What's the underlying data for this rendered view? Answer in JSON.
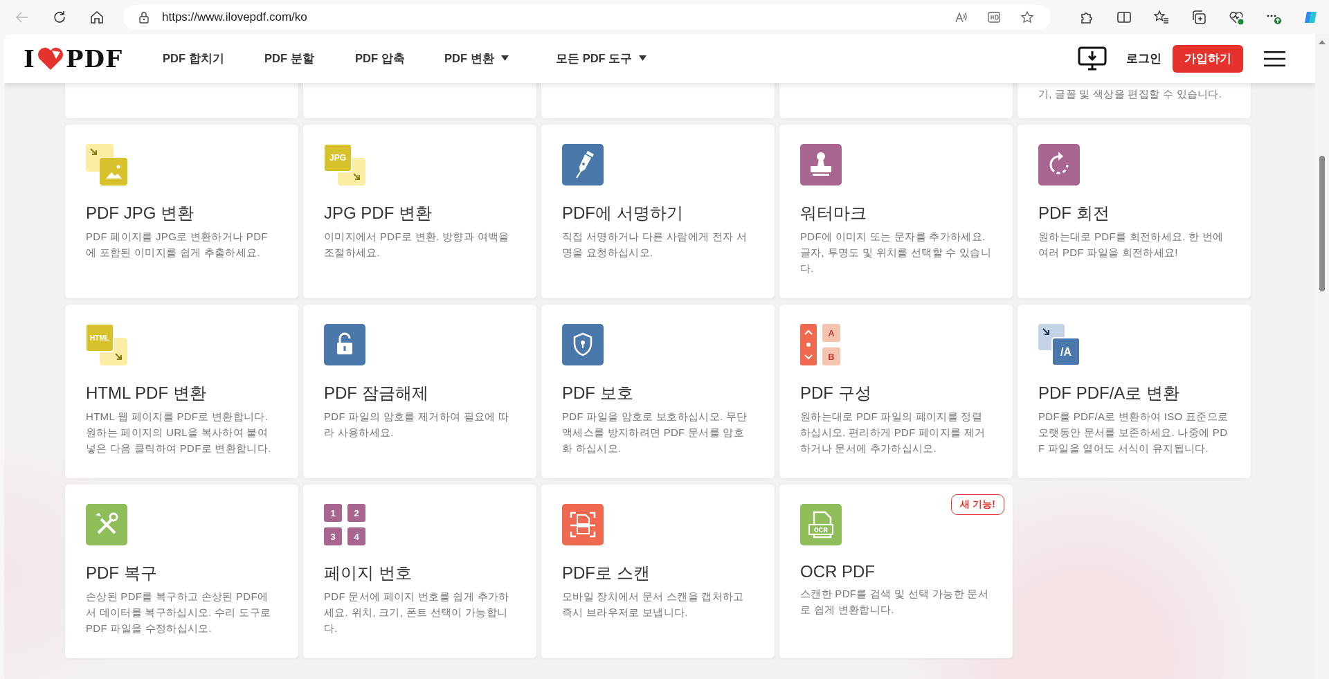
{
  "browser": {
    "url": "https://www.ilovepdf.com/ko"
  },
  "header": {
    "logo": {
      "left": "I",
      "right": "PDF"
    },
    "nav": [
      {
        "label": "PDF 합치기",
        "dropdown": false
      },
      {
        "label": "PDF 분할",
        "dropdown": false
      },
      {
        "label": "PDF 압축",
        "dropdown": false
      },
      {
        "label": "PDF 변환",
        "dropdown": true
      },
      {
        "label": "모든 PDF 도구",
        "dropdown": true
      }
    ],
    "login": "로그인",
    "signup": "가입하기"
  },
  "cut_row": {
    "description": "기, 글꼴 및 색상을 편집할 수 있습니다."
  },
  "tools": [
    {
      "title": "PDF JPG 변환",
      "description": "PDF 페이지를 JPG로 변환하거나 PDF에 포함된 이미지를 쉽게 추출하세요."
    },
    {
      "title": "JPG PDF 변환",
      "description": "이미지에서 PDF로 변환. 방향과 여백을 조절하세요.",
      "icon_text": [
        "JPG"
      ]
    },
    {
      "title": "PDF에 서명하기",
      "description": "직접 서명하거나 다른 사람에게 전자 서명을 요청하십시오."
    },
    {
      "title": "워터마크",
      "description": "PDF에 이미지 또는 문자를 추가하세요. 글자, 투명도 및 위치를 선택할 수 있습니다."
    },
    {
      "title": "PDF 회전",
      "description": "원하는대로 PDF를 회전하세요. 한 번에 여러 PDF 파일을 회전하세요!"
    },
    {
      "title": "HTML PDF 변환",
      "description": "HTML 웹 페이지를 PDF로 변환합니다. 원하는 페이지의 URL을 복사하여 붙여넣은 다음 클릭하여 PDF로 변환합니다.",
      "icon_text": [
        "HTML"
      ]
    },
    {
      "title": "PDF 잠금해제",
      "description": "PDF 파일의 암호를 제거하여 필요에 따라 사용하세요."
    },
    {
      "title": "PDF 보호",
      "description": "PDF 파일을 암호로 보호하십시오. 무단 액세스를 방지하려면 PDF 문서를 암호화 하십시오."
    },
    {
      "title": "PDF 구성",
      "description": "원하는대로 PDF 파일의 페이지를 정렬하십시오. 편리하게 PDF 페이지를 제거하거나 문서에 추가하십시오.",
      "icon_text": [
        "A",
        "B"
      ]
    },
    {
      "title": "PDF PDF/A로 변환",
      "description": "PDF를 PDF/A로 변환하여 ISO 표준으로 오랫동안 문서를 보존하세요. 나중에 PDF 파일을 열어도 서식이 유지됩니다.",
      "icon_text": [
        "/A"
      ]
    },
    {
      "title": "PDF 복구",
      "description": "손상된 PDF를 복구하고 손상된 PDF에서 데이터를 복구하십시오. 수리 도구로 PDF 파일을 수정하십시오."
    },
    {
      "title": "페이지 번호",
      "description": "PDF 문서에 페이지 번호를 쉽게 추가하세요. 위치, 크기, 폰트 선택이 가능합니다.",
      "icon_text": [
        "1",
        "2",
        "3",
        "4"
      ]
    },
    {
      "title": "PDF로 스캔",
      "description": "모바일 장치에서 문서 스캔을 캡처하고 즉시 브라우저로 보냅니다."
    },
    {
      "title": "OCR PDF",
      "description": "스캔한 PDF를 검색 및 선택 가능한 문서로 쉽게 변환합니다.",
      "icon_text": [
        "OCR"
      ],
      "badge": "새 기능!"
    }
  ]
}
